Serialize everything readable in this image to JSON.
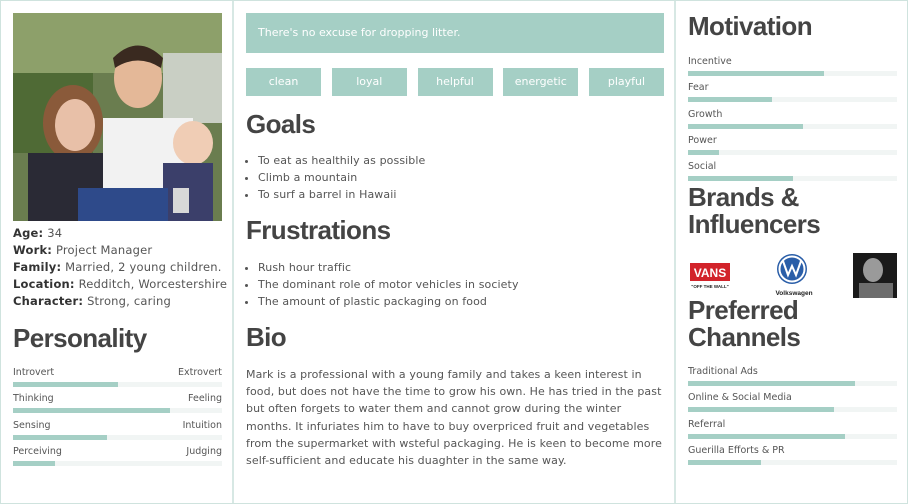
{
  "profile": {
    "age_label": "Age:",
    "age": "34",
    "work_label": "Work:",
    "work": "Project Manager",
    "family_label": "Family:",
    "family": "Married, 2 young children.",
    "location_label": "Location:",
    "location": "Redditch, Worcestershire",
    "character_label": "Character:",
    "character": "Strong, caring"
  },
  "personality": {
    "title": "Personality",
    "traits": [
      {
        "left": "Introvert",
        "right": "Extrovert",
        "value": 0.5
      },
      {
        "left": "Thinking",
        "right": "Feeling",
        "value": 0.75
      },
      {
        "left": "Sensing",
        "right": "Intuition",
        "value": 0.45
      },
      {
        "left": "Perceiving",
        "right": "Judging",
        "value": 0.2
      }
    ]
  },
  "quote": "There's no excuse for dropping litter.",
  "tags": [
    "clean",
    "loyal",
    "helpful",
    "energetic",
    "playful"
  ],
  "goals": {
    "title": "Goals",
    "items": [
      "To eat as healthily as possible",
      "Climb a mountain",
      "To surf a barrel in Hawaii"
    ]
  },
  "frustrations": {
    "title": "Frustrations",
    "items": [
      "Rush hour traffic",
      "The dominant role of motor vehicles in society",
      "The amount of plastic packaging on food"
    ]
  },
  "bio": {
    "title": "Bio",
    "text": "Mark is a professional with a young family and takes a keen interest in food, but does not have the time to grow his own. He has tried in the past but often forgets to water them and cannot grow during the winter months. It infuriates him to have to buy overpriced fruit and vegetables from the supermarket with wsteful packaging. He is keen to become more self-sufficient and educate his duaghter in the same way."
  },
  "motivation": {
    "title": "Motivation",
    "items": [
      {
        "label": "Incentive",
        "value": 0.65
      },
      {
        "label": "Fear",
        "value": 0.4
      },
      {
        "label": "Growth",
        "value": 0.55
      },
      {
        "label": "Power",
        "value": 0.15
      },
      {
        "label": "Social",
        "value": 0.5
      }
    ]
  },
  "brands": {
    "title": "Brands & Influencers",
    "vans_text": "VANS",
    "vans_sub": "\"OFF THE WALL\"",
    "vw_text": "Volkswagen"
  },
  "channels": {
    "title": "Preferred Channels",
    "items": [
      {
        "label": "Traditional Ads",
        "value": 0.8
      },
      {
        "label": "Online & Social Media",
        "value": 0.7
      },
      {
        "label": "Referral",
        "value": 0.75
      },
      {
        "label": "Guerilla Efforts & PR",
        "value": 0.35
      }
    ]
  },
  "colors": {
    "accent": "#a5cfc5",
    "track": "#f1f5f4",
    "heading": "#444444",
    "divider": "#d7e8e4"
  }
}
